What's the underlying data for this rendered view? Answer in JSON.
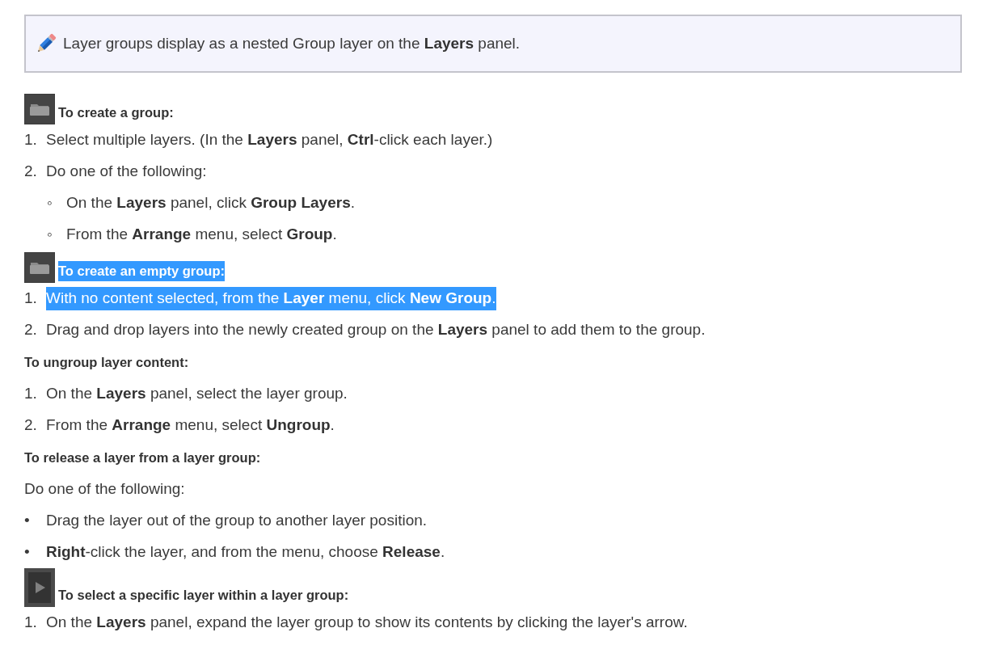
{
  "note": {
    "text": "Layer groups display as a nested Group layer on the **Layers** panel."
  },
  "sections": [
    {
      "heading": "To create a group:",
      "kind": "folder",
      "selected": false,
      "items": [
        {
          "marker": "1.",
          "text": "Select multiple layers. (In the **Layers** panel, **Ctrl**-click each layer.)",
          "selected": false
        },
        {
          "marker": "2.",
          "text": "Do one of the following:",
          "selected": false,
          "children": [
            {
              "marker": "◦",
              "text": "On the **Layers** panel, click **Group Layers**.",
              "selected": false
            },
            {
              "marker": "◦",
              "text": "From the **Arrange** menu, select **Group**.",
              "selected": false
            }
          ]
        }
      ]
    },
    {
      "heading": "To create an empty group:",
      "kind": "folder",
      "selected": true,
      "items": [
        {
          "marker": "1.",
          "text": "With no content selected, from the **Layer** menu, click **New Group**.",
          "selected": true
        },
        {
          "marker": "2.",
          "text": "Drag and drop layers into the newly created group on the **Layers** panel to add them to the group.",
          "selected": false
        }
      ]
    },
    {
      "heading": "To ungroup layer content:",
      "kind": "plain",
      "selected": false,
      "items": [
        {
          "marker": "1.",
          "text": "On the **Layers** panel, select the layer group.",
          "selected": false
        },
        {
          "marker": "2.",
          "text": "From the **Arrange** menu, select **Ungroup**.",
          "selected": false
        }
      ]
    },
    {
      "heading": "To release a layer from a layer group:",
      "kind": "plain",
      "selected": false,
      "intro": "Do one of the following:",
      "items": [
        {
          "marker": "•",
          "text": "Drag the layer out of the group to another layer position.",
          "selected": false
        },
        {
          "marker": "•",
          "text": "**Right**-click the layer, and from the menu, choose **Release**.",
          "selected": false
        }
      ]
    },
    {
      "heading": "To select a specific layer within a layer group:",
      "kind": "play",
      "selected": false,
      "items": [
        {
          "marker": "1.",
          "text": "On the **Layers** panel, expand the layer group to show its contents by clicking the layer's arrow.",
          "selected": false
        }
      ]
    }
  ]
}
